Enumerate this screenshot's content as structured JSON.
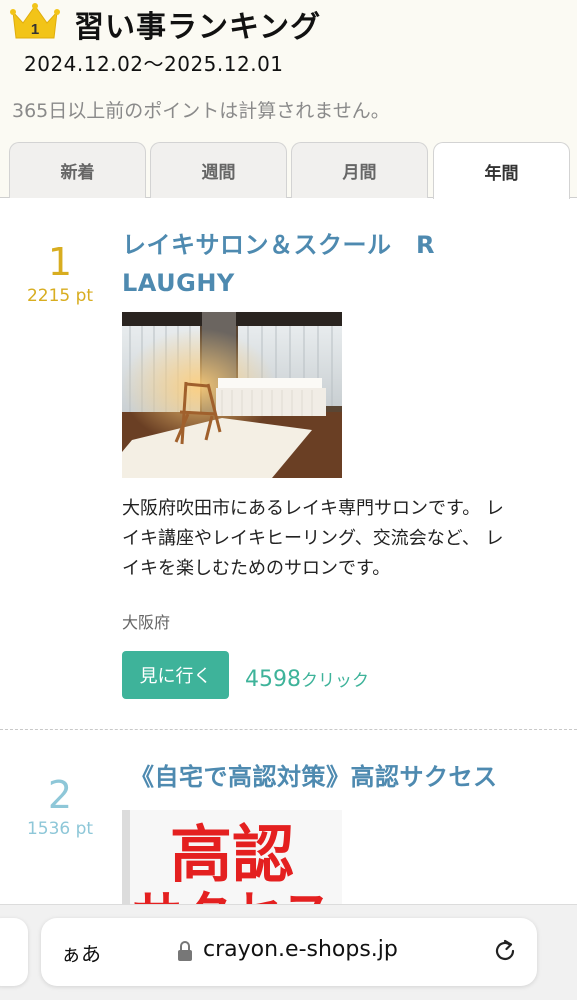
{
  "header": {
    "crown_number": "1",
    "title": "習い事ランキング",
    "period": "2024.12.02〜2025.12.01",
    "note": "365日以上前のポイントは計算されません。"
  },
  "tabs": [
    {
      "label": "新着",
      "active": false
    },
    {
      "label": "週間",
      "active": false
    },
    {
      "label": "月間",
      "active": false
    },
    {
      "label": "年間",
      "active": true
    }
  ],
  "items": [
    {
      "rank": "1",
      "points": "2215 pt",
      "title_line1": "レイキサロン＆スクール　R",
      "title_line2": "LAUGHY",
      "description_lines": [
        "大阪府吹田市にあるレイキ専門サロンです。 レ",
        "イキ講座やレイキヒーリング、交流会など、 レ",
        "イキを楽しむためのサロンです。"
      ],
      "prefecture": "大阪府",
      "button_label": "見に行く",
      "clicks": "4598",
      "clicks_unit": "クリック"
    },
    {
      "rank": "2",
      "points": "1536 pt",
      "title_line1": "《自宅で高認対策》高認サクセス",
      "image_text_line1": "高認",
      "image_text_line2": "サクセス"
    }
  ],
  "browser": {
    "aa_label": "ぁあ",
    "url": "crayon.e-shops.jp"
  },
  "colors": {
    "gold": "#d8ad20",
    "link_blue": "#4e8ab0",
    "green": "#3eb39a",
    "rank2_blue": "#8ec7d8"
  }
}
